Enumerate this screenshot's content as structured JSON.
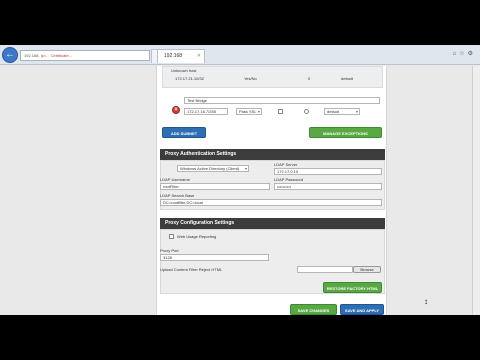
{
  "browser": {
    "back_icon": "back-arrow-icon",
    "address_host": "192.168.",
    "address_rest": "ip=... Certificate...",
    "tabs": [
      {
        "label": ""
      },
      {
        "label": "192.168"
      }
    ],
    "toolbar_icons": [
      "home-icon",
      "star-icon",
      "gear-icon"
    ]
  },
  "subnets": {
    "existing_row": {
      "top_label": "Unknown host",
      "ip": "172.17.21.10/32",
      "mode": "Yes/No",
      "count": "0",
      "group": "default"
    },
    "new_row": {
      "name": "Test Bridge",
      "ip": "172.17.18.7/255",
      "mode": "Pass SSL",
      "group": "default"
    },
    "add_subnet_label": "ADD SUBNET",
    "manage_exceptions_label": "MANAGE EXCEPTIONS"
  },
  "proxy_auth": {
    "title": "Proxy Authentication Settings",
    "directory_type": "Windows Active Directory (Client)",
    "ldap_server_label": "LDAP Server",
    "ldap_server_value": "172.17.0.10",
    "ldap_username_label": "LDAP Username",
    "ldap_username_value": "rootFilter",
    "ldap_password_label": "LDAP Password",
    "ldap_password_value": "••••••••••",
    "ldap_search_base_label": "LDAP Search Base",
    "ldap_search_base_value": "DC=rootfilter,DC=local"
  },
  "proxy_config": {
    "title": "Proxy Configuration Settings",
    "usage_reporting_label": "Web Usage Reporting",
    "proxy_port_label": "Proxy Port",
    "proxy_port_value": "3128",
    "upload_label": "Upload Content Filter Reject HTML",
    "browse_label": "Browse",
    "restore_label": "RESTORE FACTORY HTML"
  },
  "actions": {
    "save_label": "SAVE CHANGES",
    "save_apply_label": "SAVE AND APPLY"
  },
  "colors": {
    "blue_button": "#2e6fb3",
    "green_button": "#58a844",
    "section_header": "#3c3c3c",
    "delete_red": "#d23b3b"
  }
}
